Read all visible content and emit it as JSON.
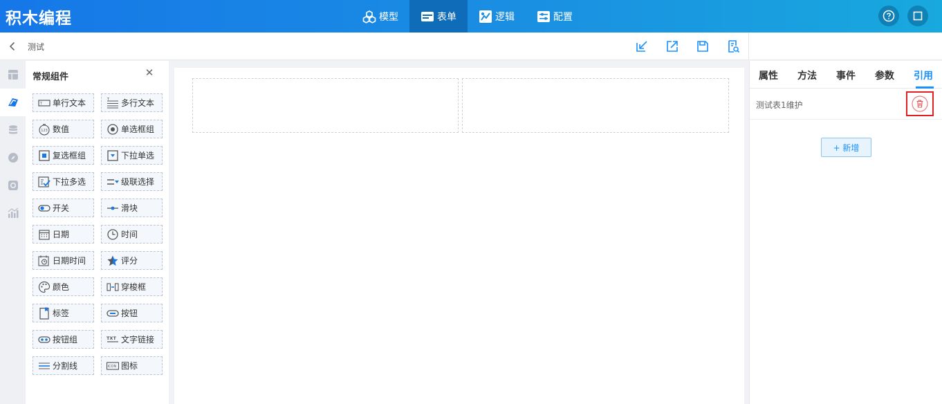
{
  "app": {
    "title": "积木编程"
  },
  "nav": {
    "items": [
      {
        "label": "模型",
        "icon": "cubes-icon"
      },
      {
        "label": "表单",
        "icon": "form-icon"
      },
      {
        "label": "逻辑",
        "icon": "logic-icon"
      },
      {
        "label": "配置",
        "icon": "config-icon"
      }
    ],
    "active": "表单"
  },
  "breadcrumb": {
    "label": "测试"
  },
  "panel": {
    "title": "常规组件",
    "components": [
      {
        "label": "单行文本",
        "icon": "single-line-text-icon"
      },
      {
        "label": "多行文本",
        "icon": "multi-line-text-icon"
      },
      {
        "label": "数值",
        "icon": "number-icon"
      },
      {
        "label": "单选框组",
        "icon": "radio-group-icon"
      },
      {
        "label": "复选框组",
        "icon": "checkbox-group-icon"
      },
      {
        "label": "下拉单选",
        "icon": "dropdown-single-icon"
      },
      {
        "label": "下拉多选",
        "icon": "dropdown-multi-icon"
      },
      {
        "label": "级联选择",
        "icon": "cascader-icon"
      },
      {
        "label": "开关",
        "icon": "switch-icon"
      },
      {
        "label": "滑块",
        "icon": "slider-icon"
      },
      {
        "label": "日期",
        "icon": "date-icon"
      },
      {
        "label": "时间",
        "icon": "time-icon"
      },
      {
        "label": "日期时间",
        "icon": "datetime-icon"
      },
      {
        "label": "评分",
        "icon": "rating-icon"
      },
      {
        "label": "颜色",
        "icon": "color-icon"
      },
      {
        "label": "穿梭框",
        "icon": "transfer-icon"
      },
      {
        "label": "标签",
        "icon": "tag-icon"
      },
      {
        "label": "按钮",
        "icon": "button-icon"
      },
      {
        "label": "按钮组",
        "icon": "button-group-icon"
      },
      {
        "label": "文字链接",
        "icon": "text-link-icon"
      },
      {
        "label": "分割线",
        "icon": "divider-icon"
      },
      {
        "label": "图标",
        "icon": "icon-component-icon"
      }
    ]
  },
  "right": {
    "tabs": [
      "属性",
      "方法",
      "事件",
      "参数",
      "引用"
    ],
    "active_tab": "引用",
    "references": [
      {
        "name": "测试表1维护"
      }
    ],
    "add_label": "+ 新增"
  },
  "colors": {
    "accent": "#1890ff",
    "header_start": "#1677e8",
    "header_end": "#18a9de",
    "danger": "#e02020"
  }
}
